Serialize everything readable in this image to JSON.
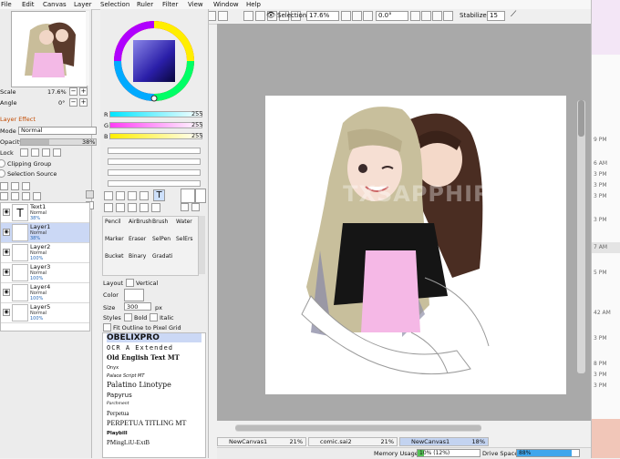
{
  "menu": [
    "File",
    "Edit",
    "Canvas",
    "Layer",
    "Selection",
    "Ruler",
    "Filter",
    "View",
    "Window",
    "Help"
  ],
  "toolbar": {
    "selection_label": "Selection",
    "zoom": "17.6%",
    "rotation": "0.0°",
    "stabilizer_label": "Stabilizer",
    "stabilizer_value": "15"
  },
  "navigator": {
    "scale_label": "Scale",
    "scale_value": "17.6%",
    "angle_label": "Angle",
    "angle_value": "0°"
  },
  "layer_effect": {
    "header": "Layer Effect",
    "mode_label": "Mode",
    "mode_value": "Normal",
    "opacity_label": "Opacity",
    "opacity_value": "38%",
    "lock_label": "Lock",
    "clipping_label": "Clipping Group",
    "selection_source_label": "Selection Source"
  },
  "layers": [
    {
      "name": "Text1",
      "mode": "Normal",
      "opacity": "38%",
      "type": "text"
    },
    {
      "name": "Layer1",
      "mode": "Normal",
      "opacity": "38%",
      "selected": true
    },
    {
      "name": "Layer2",
      "mode": "Normal",
      "opacity": "100%"
    },
    {
      "name": "Layer3",
      "mode": "Normal",
      "opacity": "100%"
    },
    {
      "name": "Layer4",
      "mode": "Normal",
      "opacity": "100%"
    },
    {
      "name": "Layer5",
      "mode": "Normal",
      "opacity": "100%"
    }
  ],
  "color_sliders": {
    "r_label": "R",
    "r_value": "255",
    "g_label": "G",
    "g_value": "255",
    "b_label": "B",
    "b_value": "255",
    "colors": {
      "r": "#00e5ff",
      "g": "#ff3df5",
      "b": "#ffee00"
    }
  },
  "tools": [
    [
      "Pencil",
      "AirBrush",
      "Brush",
      "Water"
    ],
    [
      "Marker",
      "Eraser",
      "SelPen",
      "SelErs"
    ],
    [
      "Bucket",
      "Binary",
      "Gradati",
      ""
    ]
  ],
  "text_tool": {
    "layout_label": "Layout",
    "vertical_label": "Vertical",
    "color_label": "Color",
    "size_label": "Size",
    "size_value": "300",
    "size_unit": "px",
    "styles_label": "Styles",
    "bold_label": "Bold",
    "italic_label": "Italic",
    "fit_label": "Fit Outline to Pixel Grid"
  },
  "fonts": [
    "OBELIXPRO",
    "OCR A Extended",
    "Old English Text MT",
    "Onyx",
    "Palace Script MT",
    "Palatino Linotype",
    "Papyrus",
    "Parchment",
    "Perpetua",
    "PERPETUA TITLING MT",
    "Playbill",
    "PMingLiU-ExtB"
  ],
  "canvas": {
    "watermark": "TXSAPPHIRE"
  },
  "tabs": [
    {
      "name": "NewCanvas1",
      "pct": "21%"
    },
    {
      "name": "comic.sai2",
      "pct": "21%"
    },
    {
      "name": "NewCanvas1",
      "pct": "18%",
      "active": true
    }
  ],
  "status": {
    "memory_label": "Memory Usage",
    "memory_value": "10% (12%)",
    "disk_label": "Drive Space",
    "disk_value": "88%"
  },
  "right_strip": [
    "9 PM",
    "6 AM",
    "3 PM",
    "3 PM",
    "3 PM",
    "3 PM",
    "7 AM",
    "5 PM",
    "42 AM",
    "3 PM",
    "8 PM",
    "3 PM",
    "3 PM"
  ]
}
